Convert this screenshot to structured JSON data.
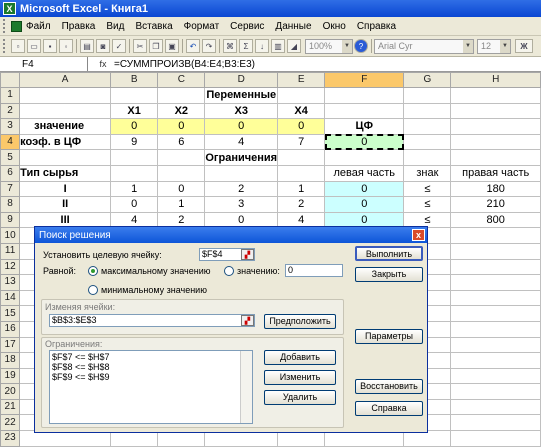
{
  "app": {
    "title": "Microsoft Excel - Книга1",
    "icon_letter": "X"
  },
  "menu": [
    "Файл",
    "Правка",
    "Вид",
    "Вставка",
    "Формат",
    "Сервис",
    "Данные",
    "Окно",
    "Справка"
  ],
  "toolbar": {
    "zoom": "100%",
    "font": "Arial Cyr",
    "size": "12",
    "bold": "Ж",
    "sigma": "Σ"
  },
  "formula_bar": {
    "cell_ref": "F4",
    "fx": "fx",
    "formula": "=СУММПРОИЗВ(B4:E4;B3:E3)"
  },
  "columns": [
    "A",
    "B",
    "C",
    "D",
    "E",
    "F",
    "G",
    "H"
  ],
  "rows": [
    {
      "n": "1",
      "cells": [
        "",
        "",
        "",
        "Переменные",
        "",
        "",
        "",
        ""
      ]
    },
    {
      "n": "2",
      "cells": [
        "",
        "X1",
        "X2",
        "X3",
        "X4",
        "",
        "",
        ""
      ]
    },
    {
      "n": "3",
      "cells": [
        "значение",
        "0",
        "0",
        "0",
        "0",
        "ЦФ",
        "",
        ""
      ]
    },
    {
      "n": "4",
      "cells": [
        "коэф. в ЦФ",
        "9",
        "6",
        "4",
        "7",
        "0",
        "",
        ""
      ]
    },
    {
      "n": "5",
      "cells": [
        "",
        "",
        "",
        "Ограничения",
        "",
        "",
        "",
        ""
      ]
    },
    {
      "n": "6",
      "cells": [
        "Тип сырья",
        "",
        "",
        "",
        "",
        "левая часть",
        "знак",
        "правая часть"
      ]
    },
    {
      "n": "7",
      "cells": [
        "I",
        "1",
        "0",
        "2",
        "1",
        "0",
        "≤",
        "180"
      ]
    },
    {
      "n": "8",
      "cells": [
        "II",
        "0",
        "1",
        "3",
        "2",
        "0",
        "≤",
        "210"
      ]
    },
    {
      "n": "9",
      "cells": [
        "III",
        "4",
        "2",
        "0",
        "4",
        "0",
        "≤",
        "800"
      ]
    },
    {
      "n": "10",
      "cells": [
        "",
        "",
        "",
        "",
        "",
        "",
        "",
        ""
      ]
    },
    {
      "n": "11",
      "cells": [
        "",
        "",
        "",
        "",
        "",
        "",
        "",
        ""
      ]
    },
    {
      "n": "12",
      "cells": [
        "",
        "",
        "",
        "",
        "",
        "",
        "",
        ""
      ]
    },
    {
      "n": "13",
      "cells": [
        "",
        "",
        "",
        "",
        "",
        "",
        "",
        ""
      ]
    },
    {
      "n": "14",
      "cells": [
        "",
        "",
        "",
        "",
        "",
        "",
        "",
        ""
      ]
    },
    {
      "n": "15",
      "cells": [
        "",
        "",
        "",
        "",
        "",
        "",
        "",
        ""
      ]
    },
    {
      "n": "16",
      "cells": [
        "",
        "",
        "",
        "",
        "",
        "",
        "",
        ""
      ]
    },
    {
      "n": "17",
      "cells": [
        "",
        "",
        "",
        "",
        "",
        "",
        "",
        ""
      ]
    },
    {
      "n": "18",
      "cells": [
        "",
        "",
        "",
        "",
        "",
        "",
        "",
        ""
      ]
    },
    {
      "n": "19",
      "cells": [
        "",
        "",
        "",
        "",
        "",
        "",
        "",
        ""
      ]
    },
    {
      "n": "20",
      "cells": [
        "",
        "",
        "",
        "",
        "",
        "",
        "",
        ""
      ]
    },
    {
      "n": "21",
      "cells": [
        "",
        "",
        "",
        "",
        "",
        "",
        "",
        ""
      ]
    },
    {
      "n": "22",
      "cells": [
        "",
        "",
        "",
        "",
        "",
        "",
        "",
        ""
      ]
    },
    {
      "n": "23",
      "cells": [
        "",
        "",
        "",
        "",
        "",
        "",
        "",
        ""
      ]
    }
  ],
  "colors": {
    "yellow": "#ffff99",
    "green": "#ccffcc",
    "cyan": "#ccffff",
    "title_blue": "#0a46d2"
  },
  "dialog": {
    "title": "Поиск решения",
    "set_target_label": "Установить целевую ячейку:",
    "target_value": "$F$4",
    "equal_label": "Равной:",
    "opt_max": "максимальному значению",
    "opt_value": "значению:",
    "value_input": "0",
    "opt_min": "минимальному значению",
    "changing_label": "Изменяя ячейки:",
    "changing_value": "$B$3:$E$3",
    "constraints_label": "Ограничения:",
    "constraints": [
      "$F$7 <= $H$7",
      "$F$8 <= $H$8",
      "$F$9 <= $H$9"
    ],
    "btn_solve": "Выполнить",
    "btn_close": "Закрыть",
    "btn_guess": "Предположить",
    "btn_options": "Параметры",
    "btn_add": "Добавить",
    "btn_change": "Изменить",
    "btn_delete": "Удалить",
    "btn_reset": "Восстановить",
    "btn_help": "Справка",
    "close_x": "x"
  }
}
